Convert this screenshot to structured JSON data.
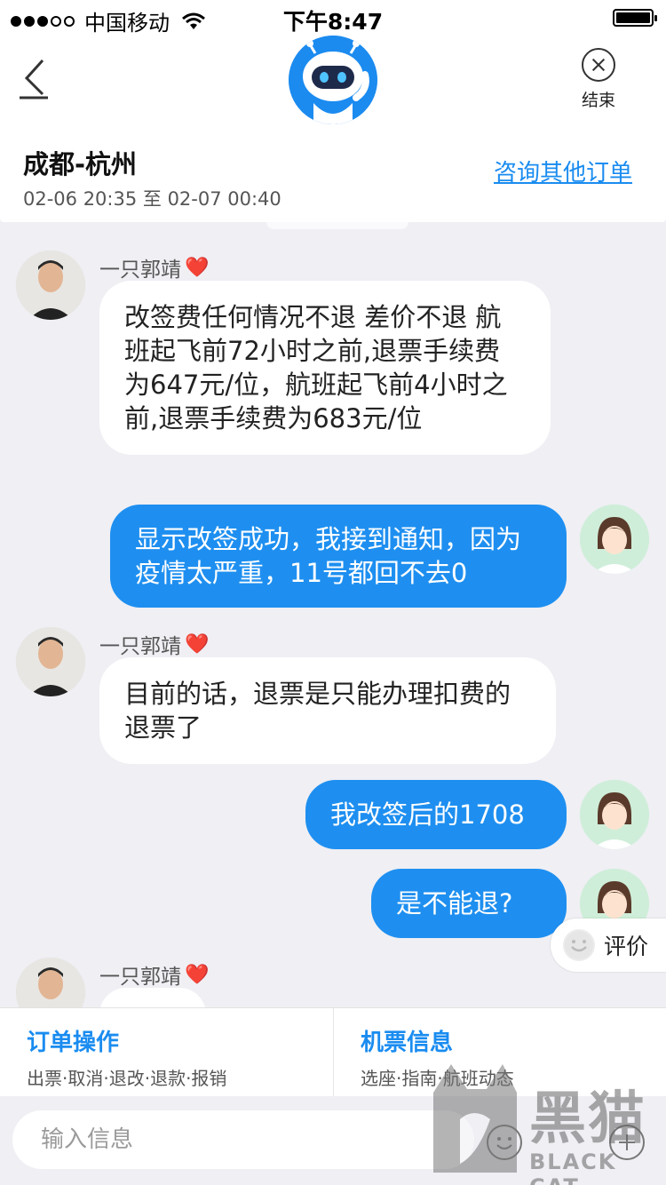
{
  "status_bar": {
    "carrier": "中国移动",
    "time": "下午8:47"
  },
  "nav": {
    "end_label": "结束"
  },
  "order": {
    "route": "成都-杭州",
    "time_range": "02-06 20:35 至 02-07 00:40",
    "other_orders_link": "咨询其他订单"
  },
  "messages": [
    {
      "sender": "agent",
      "name": "一只郭靖",
      "heart": "❤️",
      "text": "改签费任何情况不退 差价不退 航班起飞前72小时之前,退票手续费为647元/位，航班起飞前4小时之前,退票手续费为683元/位"
    },
    {
      "sender": "user",
      "text": "显示改签成功，我接到通知，因为疫情太严重，11号都回不去0"
    },
    {
      "sender": "agent",
      "name": "一只郭靖",
      "heart": "❤️",
      "text": "目前的话，退票是只能办理扣费的退票了"
    },
    {
      "sender": "user",
      "text": "我改签后的1708"
    },
    {
      "sender": "user",
      "text": "是不能退?"
    },
    {
      "sender": "agent",
      "name": "一只郭靖",
      "heart": "❤️",
      "text": ""
    }
  ],
  "rate": {
    "label": "评价"
  },
  "actions": [
    {
      "title": "订单操作",
      "subtitle": "出票·取消·退改·退款·报销"
    },
    {
      "title": "机票信息",
      "subtitle": "选座·指南·航班动态"
    }
  ],
  "input": {
    "placeholder": "输入信息"
  },
  "watermark": {
    "text": "黑猫",
    "subtext": "BLACK CAT"
  },
  "colors": {
    "accent": "#1e8ff0",
    "background": "#efeff4"
  }
}
